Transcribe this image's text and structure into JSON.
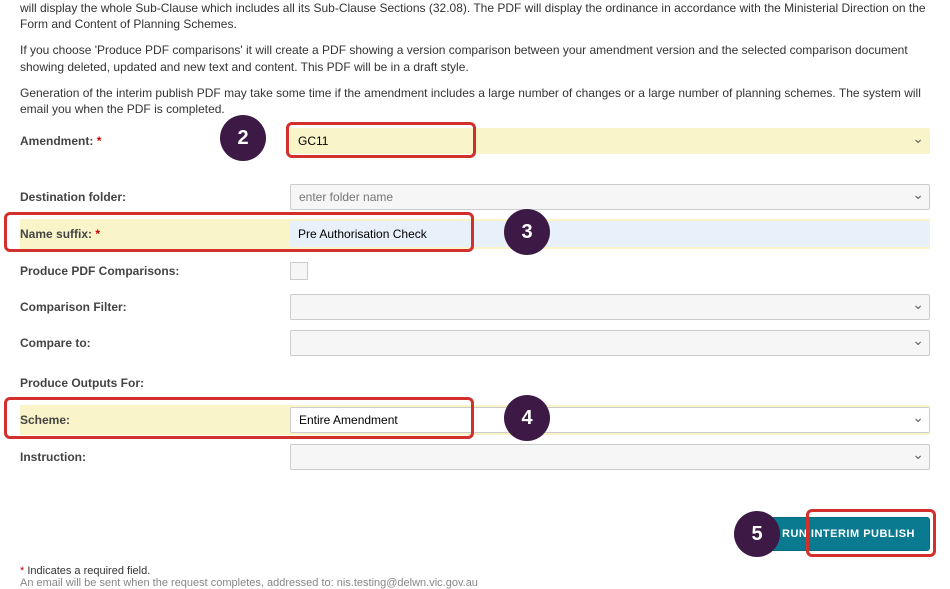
{
  "intro": {
    "p1_tail": "will display the whole Sub-Clause which includes all its Sub-Clause Sections (32.08). The PDF will display the ordinance in accordance with the Ministerial Direction on the Form and Content of Planning Schemes.",
    "p2": "If you choose 'Produce PDF comparisons' it will create a PDF showing a version comparison between your amendment version and the selected comparison document showing deleted, updated and new text and content. This PDF will be in a draft style.",
    "p3": "Generation of the interim publish PDF may take some time if the amendment includes a large number of changes or a large number of planning schemes. The system will email you when the PDF is completed."
  },
  "labels": {
    "amendment": "Amendment:",
    "destination_folder": "Destination folder:",
    "name_suffix": "Name suffix:",
    "produce_pdf": "Produce PDF Comparisons:",
    "comparison_filter": "Comparison Filter:",
    "compare_to": "Compare to:",
    "produce_outputs": "Produce Outputs For:",
    "scheme": "Scheme:",
    "instruction": "Instruction:"
  },
  "values": {
    "amendment": "GC11",
    "destination_folder_placeholder": "enter folder name",
    "name_suffix": "Pre Authorisation Check",
    "scheme": "Entire Amendment"
  },
  "steps": {
    "s2": "2",
    "s3": "3",
    "s4": "4",
    "s5": "5"
  },
  "button": {
    "run": "RUN INTERIM PUBLISH"
  },
  "footer": {
    "required": "Indicates a required field.",
    "email_note": "An email will be sent when the request completes, addressed to: nis.testing@delwn.vic.gov.au"
  }
}
